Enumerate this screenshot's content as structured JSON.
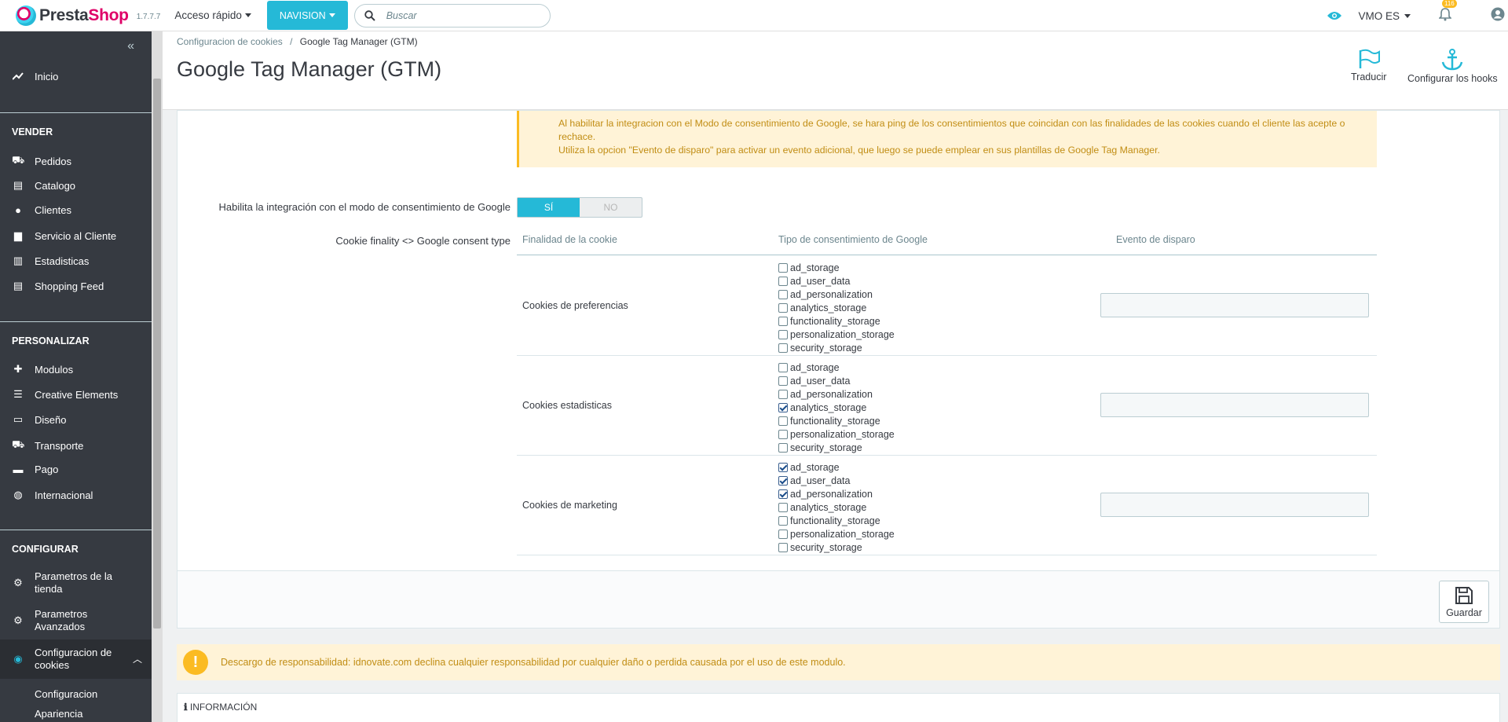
{
  "topbar": {
    "logo_part1": "Presta",
    "logo_part2": "Shop",
    "version": "1.7.7.7",
    "quick_access": "Acceso rápido",
    "nav_button": "NAVISION",
    "search_placeholder": "Buscar",
    "shop_name": "VMO ES",
    "notifications_count": "116"
  },
  "sidebar": {
    "items_top": [
      {
        "label": "Inicio",
        "icon": "trending-up-icon"
      }
    ],
    "section_vender": "VENDER",
    "vender": [
      {
        "label": "Pedidos",
        "icon": "basket-icon"
      },
      {
        "label": "Catalogo",
        "icon": "store-icon"
      },
      {
        "label": "Clientes",
        "icon": "user-circle-icon"
      },
      {
        "label": "Servicio al Cliente",
        "icon": "chat-icon"
      },
      {
        "label": "Estadisticas",
        "icon": "bar-chart-icon"
      },
      {
        "label": "Shopping Feed",
        "icon": "store-icon"
      }
    ],
    "section_personalizar": "PERSONALIZAR",
    "personalizar": [
      {
        "label": "Modulos",
        "icon": "puzzle-icon"
      },
      {
        "label": "Creative Elements",
        "icon": "layers-icon"
      },
      {
        "label": "Diseño",
        "icon": "monitor-icon"
      },
      {
        "label": "Transporte",
        "icon": "truck-icon"
      },
      {
        "label": "Pago",
        "icon": "credit-card-icon"
      },
      {
        "label": "Internacional",
        "icon": "globe-icon"
      }
    ],
    "section_configurar": "CONFIGURAR",
    "configurar": [
      {
        "label1": "Parametros de la",
        "label2": "tienda",
        "icon": "gear-icon"
      },
      {
        "label1": "Parametros",
        "label2": "Avanzados",
        "icon": "gear-box-icon"
      },
      {
        "label1": "Configuracion de",
        "label2": "cookies",
        "icon": "cookie-icon"
      }
    ],
    "sub_items": [
      "Configuracion",
      "Apariencia"
    ]
  },
  "header": {
    "breadcrumb_parent": "Configuracion de cookies",
    "breadcrumb_sep": "/",
    "breadcrumb_current": "Google Tag Manager (GTM)",
    "title": "Google Tag Manager (GTM)",
    "btn_translate": "Traducir",
    "btn_hooks": "Configurar los hooks"
  },
  "form": {
    "warning_line1": "Al habilitar la integracion con el Modo de consentimiento de Google, se hara ping de los consentimientos que coincidan con las finalidades de las cookies cuando el cliente las acepte o",
    "warning_line2": "rechace.",
    "warning_line3": "Utiliza la opcion \"Evento de disparo\" para activar un evento adicional, que luego se puede emplear en sus plantillas de Google Tag Manager.",
    "enable_label": "Habilita la integración con el modo de consentimiento de Google",
    "toggle_yes": "SÍ",
    "toggle_no": "NO",
    "mapping_label": "Cookie finality <> Google consent type",
    "col_finality": "Finalidad de la cookie",
    "col_type": "Tipo de consentimiento de Google",
    "col_event": "Evento de disparo",
    "rows": [
      {
        "name": "Cookies de preferencias",
        "checks": [
          false,
          false,
          false,
          false,
          false,
          false,
          false
        ],
        "event": ""
      },
      {
        "name": "Cookies estadisticas",
        "checks": [
          false,
          false,
          false,
          true,
          false,
          false,
          false
        ],
        "event": ""
      },
      {
        "name": "Cookies de marketing",
        "checks": [
          true,
          true,
          true,
          false,
          false,
          false,
          false
        ],
        "event": ""
      }
    ],
    "consent_types": [
      "ad_storage",
      "ad_user_data",
      "ad_personalization",
      "analytics_storage",
      "functionality_storage",
      "personalization_storage",
      "security_storage"
    ],
    "save_label": "Guardar"
  },
  "disclaimer": "Descargo de responsabilidad: idnovate.com declina cualquier responsabilidad por cualquier daño o perdida causada por el uso de este modulo.",
  "info_title": "INFORMACIÓN"
}
